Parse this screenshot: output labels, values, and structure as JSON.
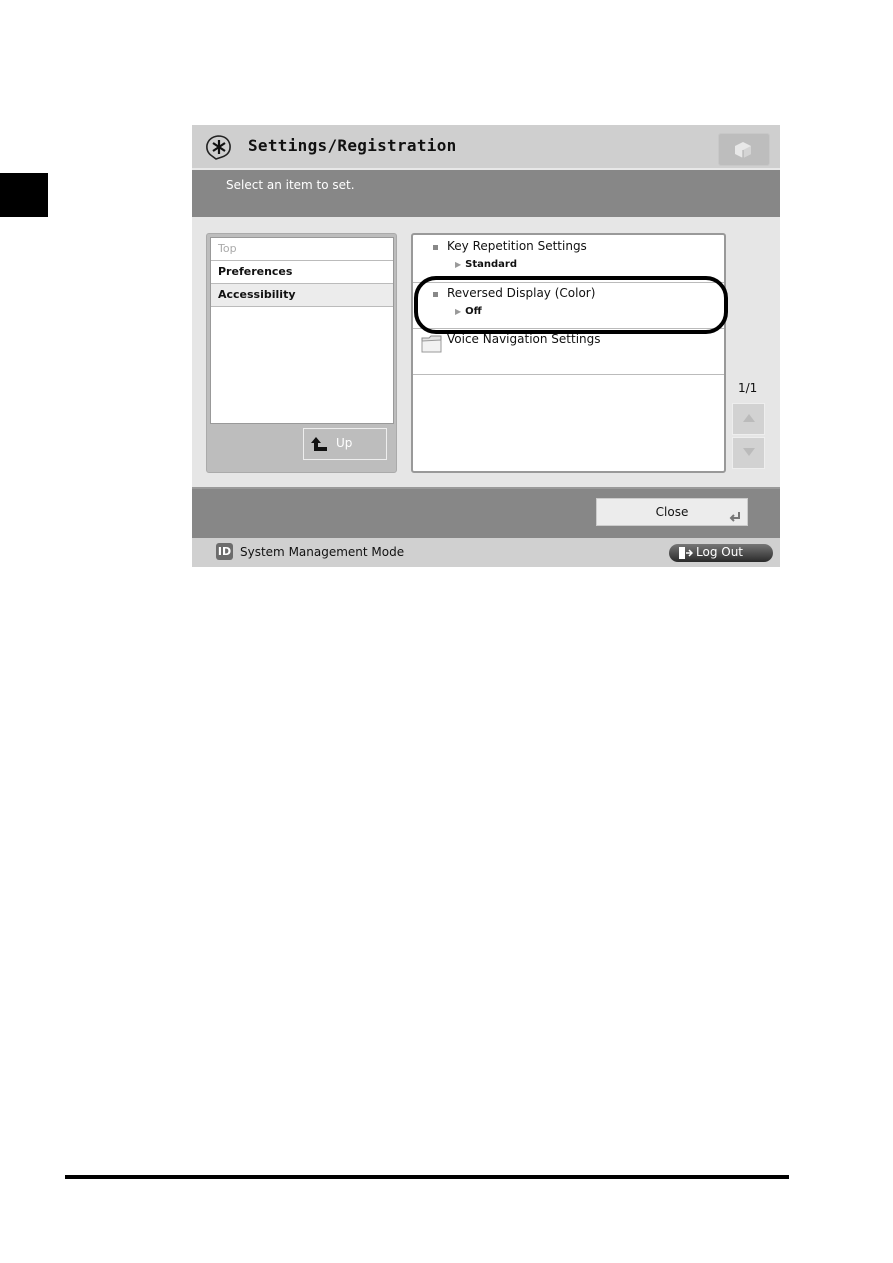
{
  "header": {
    "title": "Settings/Registration",
    "title_icon": "settings-asterisk-icon",
    "top_button_icon": "cube-icon"
  },
  "message": "Select an item to set.",
  "left_nav": {
    "items": [
      {
        "label": "Top",
        "state": "disabled"
      },
      {
        "label": "Preferences",
        "state": "normal"
      },
      {
        "label": "Accessibility",
        "state": "selected"
      }
    ],
    "up_label": "Up"
  },
  "settings_list": {
    "items": [
      {
        "label": "Key Repetition Settings",
        "value": "Standard",
        "type": "setting"
      },
      {
        "label": "Reversed Display (Color)",
        "value": "Off",
        "type": "setting",
        "highlighted": true
      },
      {
        "label": "Voice Navigation Settings",
        "type": "folder"
      }
    ],
    "page_indicator": "1/1"
  },
  "footer": {
    "close_label": "Close",
    "mode_badge": "ID",
    "mode_label": "System Management Mode",
    "logout_label": "Log Out"
  }
}
